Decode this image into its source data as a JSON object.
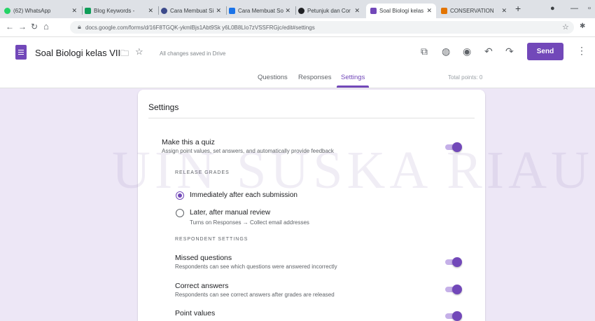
{
  "browser": {
    "tabs": [
      {
        "label": "(62) WhatsApp",
        "color": "#25d366",
        "active": false
      },
      {
        "label": "Blog Keywords -",
        "color": "#0f9d58",
        "active": false
      },
      {
        "label": "Cara Membuat Si",
        "color": "#3c4a8b",
        "active": false
      },
      {
        "label": "Cara Membuat So",
        "color": "#1a73e8",
        "active": false
      },
      {
        "label": "Petunjuk dan Cor",
        "color": "#202124",
        "active": false
      },
      {
        "label": "Soal Biologi kelas",
        "color": "#7248b9",
        "active": true
      },
      {
        "label": "CONSERVATION",
        "color": "#e37400",
        "active": false
      }
    ],
    "url": "docs.google.com/forms/d/16F8TGQK-ykmlBjs1Abt9Sk y6L0B8LIo7zVSSFRGjc/edit#settings"
  },
  "form": {
    "title": "Soal Biologi kelas VII",
    "saved_status": "All changes saved in Drive",
    "send_label": "Send",
    "tabs": [
      {
        "label": "Questions",
        "active": false
      },
      {
        "label": "Responses",
        "active": false
      },
      {
        "label": "Settings",
        "active": true
      }
    ],
    "total_points": "Total points: 0"
  },
  "settings": {
    "title": "Settings",
    "quiz": {
      "title": "Make this a quiz",
      "desc": "Assign point values, set answers, and automatically provide feedback",
      "enabled": true
    },
    "release_grades": {
      "heading": "RELEASE GRADES",
      "options": [
        {
          "label": "Immediately after each submission",
          "selected": true
        },
        {
          "label": "Later, after manual review",
          "sub": "Turns on Responses → Collect email addresses",
          "selected": false
        }
      ]
    },
    "respondent": {
      "heading": "RESPONDENT SETTINGS",
      "items": [
        {
          "title": "Missed questions",
          "desc": "Respondents can see which questions were answered incorrectly",
          "enabled": true
        },
        {
          "title": "Correct answers",
          "desc": "Respondents can see correct answers after grades are released",
          "enabled": true
        },
        {
          "title": "Point values",
          "enabled": true
        }
      ]
    }
  },
  "watermark": "UIN SUSKA RIAU",
  "colors": {
    "accent": "#7248b9",
    "background": "#ede7f6"
  }
}
